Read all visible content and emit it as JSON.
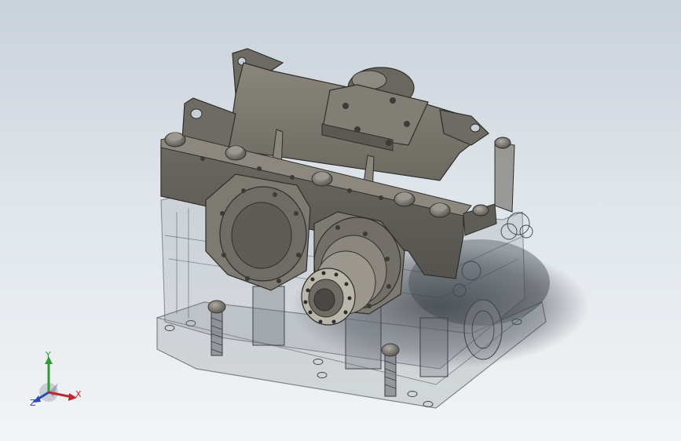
{
  "viewport": {
    "background_top": "#c9d1da",
    "background_bottom": "#f2f4f6",
    "model": {
      "subject": "gearbox-reducer-assembly",
      "housing_color": "#6f6c65",
      "transparent_body_color": "#8a8f95"
    }
  },
  "triad": {
    "x_label": "X",
    "y_label": "Y",
    "z_label": "Z",
    "x_color": "#c0262d",
    "y_color": "#2e9a38",
    "z_color": "#2a48b8"
  }
}
